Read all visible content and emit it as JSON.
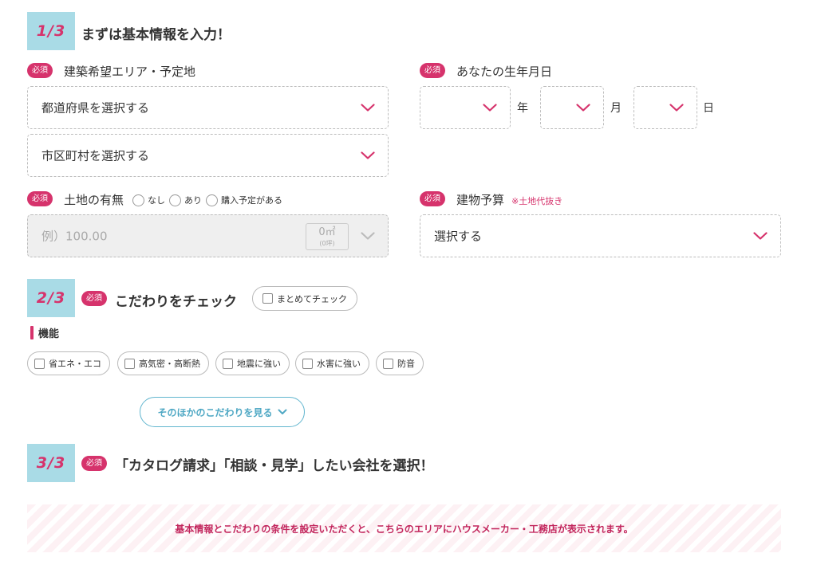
{
  "colors": {
    "accent": "#d6336c",
    "step_badge_bg": "#a9dbe6",
    "link_blue": "#4fa8c4"
  },
  "step1": {
    "badge": "1/3",
    "title": "まずは基本情報を入力！",
    "area": {
      "required": "必須",
      "label": "建築希望エリア・予定地",
      "prefecture_select": "都道府県を選択する",
      "city_select": "市区町村を選択する"
    },
    "birth": {
      "required": "必須",
      "label": "あなたの生年月日",
      "year_unit": "年",
      "month_unit": "月",
      "day_unit": "日"
    },
    "land": {
      "required": "必須",
      "label": "土地の有無",
      "options": [
        "なし",
        "あり",
        "購入予定がある"
      ],
      "area_placeholder": "例）100.00",
      "unit_m2": "0㎡",
      "unit_tsubo": "(0坪)"
    },
    "budget": {
      "required": "必須",
      "label": "建物予算",
      "note": "※土地代抜き",
      "select": "選択する"
    }
  },
  "step2": {
    "badge": "2/3",
    "required": "必須",
    "title": "こだわりをチェック",
    "check_all": "まとめてチェック",
    "section_label": "機能",
    "options": [
      "省エネ・エコ",
      "高気密・高断熱",
      "地震に強い",
      "水害に強い",
      "防音"
    ],
    "more_button": "そのほかのこだわりを見る"
  },
  "step3": {
    "badge": "3/3",
    "required": "必須",
    "title": "「カタログ請求」「相談・見学」したい会社を選択！",
    "notice": "基本情報とこだわりの条件を設定いただくと、こちらのエリアにハウスメーカー・工務店が表示されます。"
  },
  "icons": {
    "dropdown": "chevron-down-icon"
  }
}
